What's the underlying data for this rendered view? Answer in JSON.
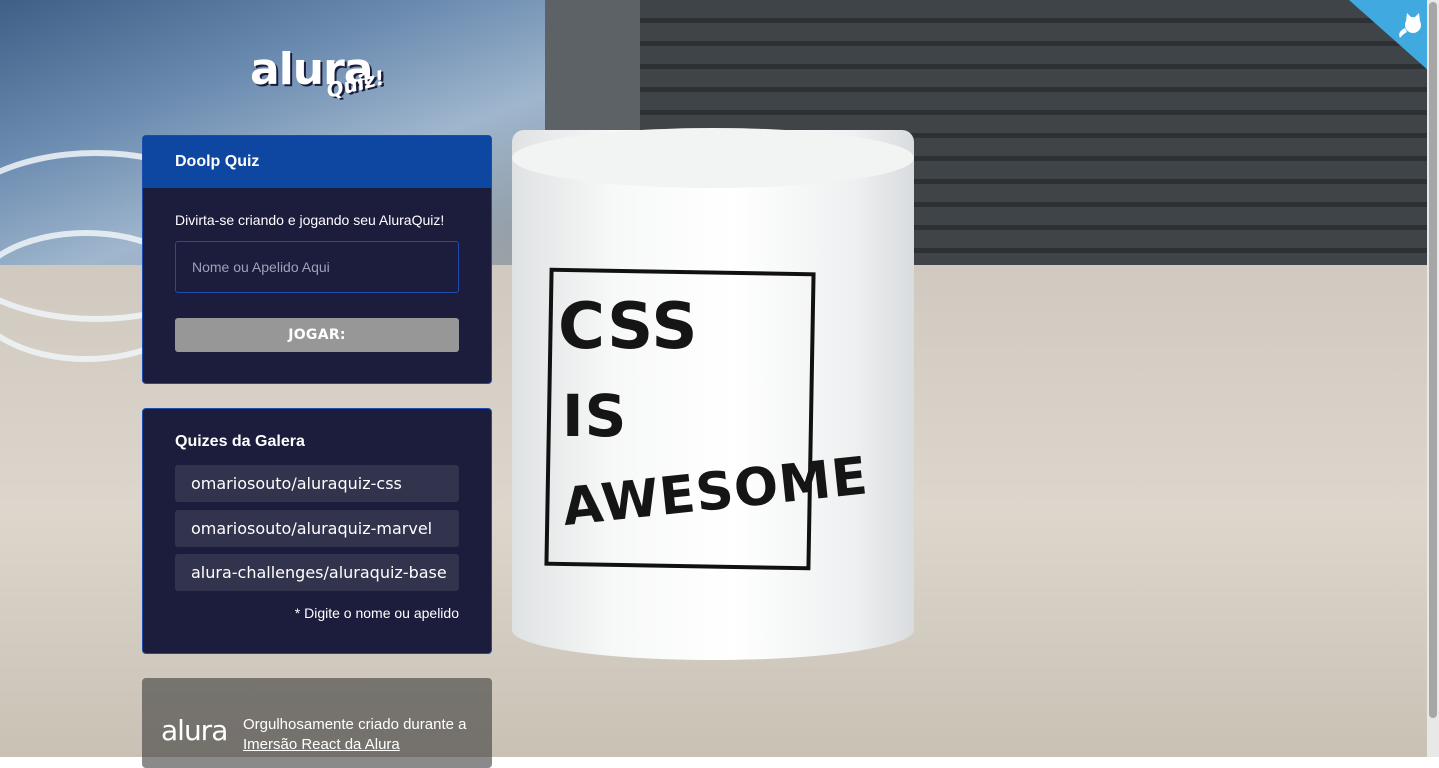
{
  "logo": {
    "main": "alura",
    "sub": "Quiz!"
  },
  "mug": {
    "line1": "CSS",
    "line2": "IS",
    "line3": "AWESOME"
  },
  "main_card": {
    "title": "Doolp Quiz",
    "subtitle": "Divirta-se criando e jogando seu AluraQuiz!",
    "input_placeholder": "Nome ou Apelido Aqui",
    "button_label": "JOGAR:"
  },
  "gallery_card": {
    "title": "Quizes da Galera",
    "items": [
      "omariosouto/aluraquiz-css",
      "omariosouto/aluraquiz-marvel",
      "alura-challenges/aluraquiz-base"
    ],
    "hint": "* Digite o nome ou apelido"
  },
  "footer": {
    "logo": "alura",
    "text": "Orgulhosamente criado durante a ",
    "link": "Imersão React da Alura"
  },
  "colors": {
    "card_bg": "#1c1c3c",
    "card_header": "#0d47a1",
    "card_border": "#1e4cae",
    "button_bg": "#979797",
    "github_corner": "#3fa9e0"
  },
  "icons": {
    "github": "octocat-icon"
  }
}
